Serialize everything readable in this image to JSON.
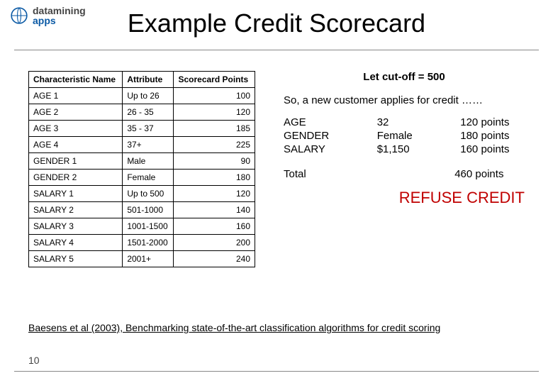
{
  "logo": {
    "line1": "datamining",
    "line2": "apps"
  },
  "title": "Example Credit Scorecard",
  "table": {
    "headers": [
      "Characteristic Name",
      "Attribute",
      "Scorecard Points"
    ],
    "rows": [
      {
        "name": "AGE 1",
        "attr": "Up to 26",
        "pts": "100"
      },
      {
        "name": "AGE 2",
        "attr": "26 - 35",
        "pts": "120"
      },
      {
        "name": "AGE 3",
        "attr": "35 - 37",
        "pts": "185"
      },
      {
        "name": "AGE 4",
        "attr": "37+",
        "pts": "225"
      },
      {
        "name": "GENDER 1",
        "attr": "Male",
        "pts": "90"
      },
      {
        "name": "GENDER 2",
        "attr": "Female",
        "pts": "180"
      },
      {
        "name": "SALARY 1",
        "attr": "Up to 500",
        "pts": "120"
      },
      {
        "name": "SALARY 2",
        "attr": "501-1000",
        "pts": "140"
      },
      {
        "name": "SALARY 3",
        "attr": "1001-1500",
        "pts": "160"
      },
      {
        "name": "SALARY 4",
        "attr": "1501-2000",
        "pts": "200"
      },
      {
        "name": "SALARY 5",
        "attr": "2001+",
        "pts": "240"
      }
    ]
  },
  "right": {
    "cutoff": "Let cut-off = 500",
    "apply_line": "So, a new customer applies for credit ……",
    "score_rows": [
      {
        "label": "AGE",
        "value": "32",
        "points": "120 points"
      },
      {
        "label": "GENDER",
        "value": "Female",
        "points": "180 points"
      },
      {
        "label": "SALARY",
        "value": "$1,150",
        "points": "160 points"
      }
    ],
    "total_label": "Total",
    "total_points": "460 points",
    "decision": "REFUSE CREDIT"
  },
  "citation": "Baesens et al (2003), Benchmarking state-of-the-art classification algorithms for credit scoring",
  "page_number": "10"
}
